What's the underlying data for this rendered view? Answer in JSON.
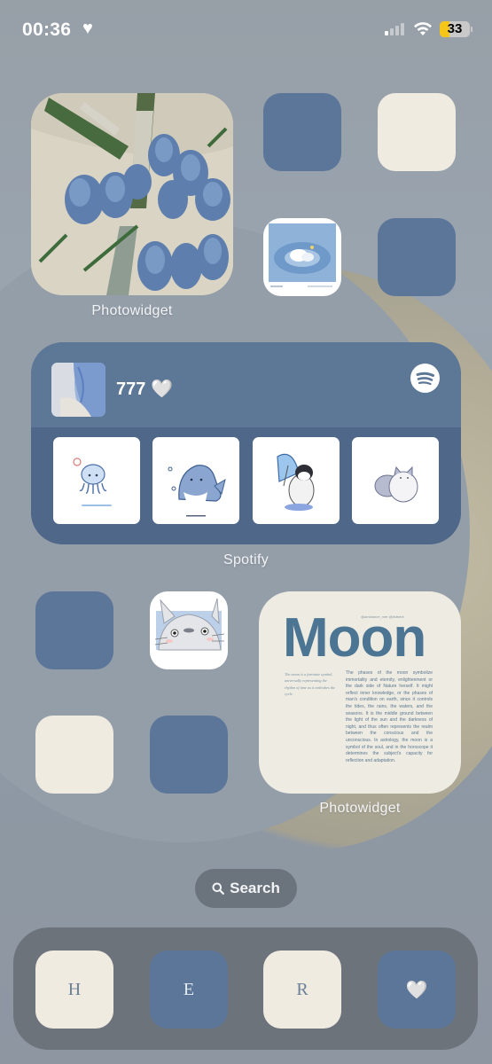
{
  "status_bar": {
    "time": "00:36",
    "time_suffix_icon": "heart-icon",
    "signal_bars_active": 1,
    "signal_bars_total": 4,
    "wifi": "connected",
    "battery_percent": "33",
    "battery_level": 0.33,
    "low_power_mode": true
  },
  "colors": {
    "accent_blue": "#5c7699",
    "cream": "#efebe1",
    "dock": "#6c737b",
    "battery_yellow": "#f5c518",
    "moon_title": "#4c7593"
  },
  "home": {
    "photowidget_top": {
      "label": "Photowidget",
      "image": "blue tulips bouquet photo"
    },
    "top_right_icons": [
      {
        "name": "blue-app-icon",
        "style": "blue"
      },
      {
        "name": "cream-app-icon",
        "style": "cream"
      },
      {
        "name": "sleeping-character-app-icon",
        "style": "image"
      },
      {
        "name": "blue-app-icon-2",
        "style": "blue"
      }
    ],
    "spotify_widget": {
      "label": "Spotify",
      "track_title": "777",
      "track_emoji": "🤍",
      "logo_icon": "spotify-icon",
      "thumbnails": [
        {
          "name": "jellyfish-sticker"
        },
        {
          "name": "shark-sticker"
        },
        {
          "name": "penguin-umbrella-sticker"
        },
        {
          "name": "fluffy-cat-sticker"
        }
      ]
    },
    "middle_left_icons": [
      {
        "name": "blue-app-icon-3",
        "style": "blue"
      },
      {
        "name": "totoro-app-icon",
        "style": "image"
      },
      {
        "name": "cream-app-icon-2",
        "style": "cream"
      },
      {
        "name": "blue-app-icon-4",
        "style": "blue"
      }
    ],
    "moon_widget": {
      "label": "Photowidget",
      "credit": "@ambiance_mer @itsfnerk",
      "title": "Moon",
      "side_text": "The moon is a feminine symbol, universally representing the rhythm of time as it embodies the cycle.",
      "body_text": "The phases of the moon symbolize immortality and eternity, enlightenment or the dark side of Nature herself. It might reflect inner knowledge, or the phases of man's condition on earth, since it controls the tides, the rains, the waters, and the seasons. It is the middle ground between the light of the sun and the darkness of night, and thus often represents the realm between the conscious and the unconscious. In astrology, the moon is a symbol of the soul, and in the horoscope it determines the subject's capacity for reflection and adaptation."
    },
    "search": {
      "label": "Search",
      "icon": "search-icon"
    }
  },
  "dock": {
    "apps": [
      {
        "label": "H",
        "style": "cream"
      },
      {
        "label": "E",
        "style": "blue"
      },
      {
        "label": "R",
        "style": "cream"
      },
      {
        "label": "🤍",
        "style": "blue"
      }
    ]
  }
}
